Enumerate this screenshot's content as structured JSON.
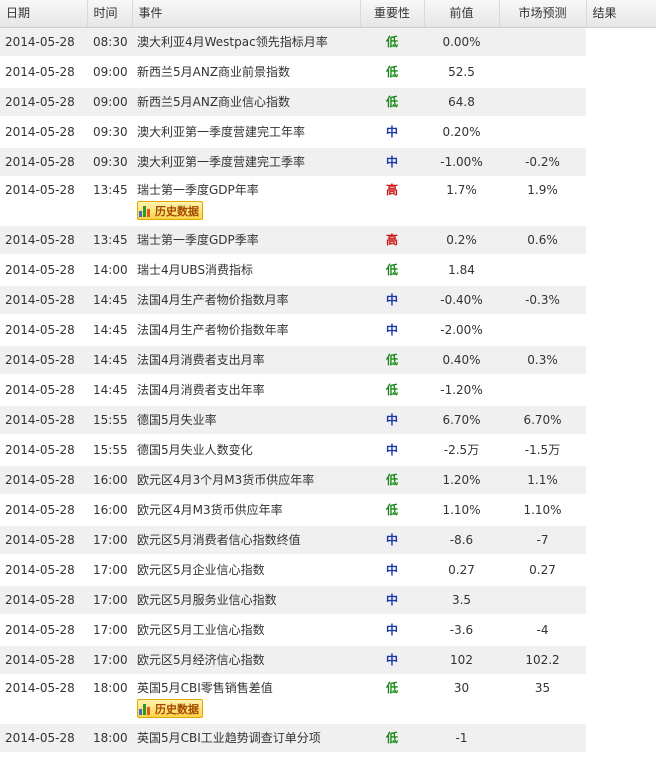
{
  "headers": {
    "date": "日期",
    "time": "时间",
    "event": "事件",
    "importance": "重要性",
    "previous": "前值",
    "forecast": "市场预测",
    "result": "结果"
  },
  "history_label": "历史数据",
  "colors": {
    "low": "#1a8a1a",
    "mid": "#1a3aa8",
    "high": "#c81414"
  },
  "rows": [
    {
      "date": "2014-05-28",
      "time": "08:30",
      "event": "澳大利亚4月Westpac领先指标月率",
      "importance": "低",
      "level": "low",
      "previous": "0.00%",
      "forecast": "",
      "has_history": false
    },
    {
      "date": "2014-05-28",
      "time": "09:00",
      "event": "新西兰5月ANZ商业前景指数",
      "importance": "低",
      "level": "low",
      "previous": "52.5",
      "forecast": "",
      "has_history": false
    },
    {
      "date": "2014-05-28",
      "time": "09:00",
      "event": "新西兰5月ANZ商业信心指数",
      "importance": "低",
      "level": "low",
      "previous": "64.8",
      "forecast": "",
      "has_history": false
    },
    {
      "date": "2014-05-28",
      "time": "09:30",
      "event": "澳大利亚第一季度营建完工年率",
      "importance": "中",
      "level": "mid",
      "previous": "0.20%",
      "forecast": "",
      "has_history": false
    },
    {
      "date": "2014-05-28",
      "time": "09:30",
      "event": "澳大利亚第一季度营建完工季率",
      "importance": "中",
      "level": "mid",
      "previous": "-1.00%",
      "forecast": "-0.2%",
      "has_history": false
    },
    {
      "date": "2014-05-28",
      "time": "13:45",
      "event": "瑞士第一季度GDP年率",
      "importance": "高",
      "level": "high",
      "previous": "1.7%",
      "forecast": "1.9%",
      "has_history": true
    },
    {
      "date": "2014-05-28",
      "time": "13:45",
      "event": "瑞士第一季度GDP季率",
      "importance": "高",
      "level": "high",
      "previous": "0.2%",
      "forecast": "0.6%",
      "has_history": false
    },
    {
      "date": "2014-05-28",
      "time": "14:00",
      "event": "瑞士4月UBS消费指标",
      "importance": "低",
      "level": "low",
      "previous": "1.84",
      "forecast": "",
      "has_history": false
    },
    {
      "date": "2014-05-28",
      "time": "14:45",
      "event": "法国4月生产者物价指数月率",
      "importance": "中",
      "level": "mid",
      "previous": "-0.40%",
      "forecast": "-0.3%",
      "has_history": false
    },
    {
      "date": "2014-05-28",
      "time": "14:45",
      "event": "法国4月生产者物价指数年率",
      "importance": "中",
      "level": "mid",
      "previous": "-2.00%",
      "forecast": "",
      "has_history": false
    },
    {
      "date": "2014-05-28",
      "time": "14:45",
      "event": "法国4月消费者支出月率",
      "importance": "低",
      "level": "low",
      "previous": "0.40%",
      "forecast": "0.3%",
      "has_history": false
    },
    {
      "date": "2014-05-28",
      "time": "14:45",
      "event": "法国4月消费者支出年率",
      "importance": "低",
      "level": "low",
      "previous": "-1.20%",
      "forecast": "",
      "has_history": false
    },
    {
      "date": "2014-05-28",
      "time": "15:55",
      "event": "德国5月失业率",
      "importance": "中",
      "level": "mid",
      "previous": "6.70%",
      "forecast": "6.70%",
      "has_history": false
    },
    {
      "date": "2014-05-28",
      "time": "15:55",
      "event": "德国5月失业人数变化",
      "importance": "中",
      "level": "mid",
      "previous": "-2.5万",
      "forecast": "-1.5万",
      "has_history": false
    },
    {
      "date": "2014-05-28",
      "time": "16:00",
      "event": "欧元区4月3个月M3货币供应年率",
      "importance": "低",
      "level": "low",
      "previous": "1.20%",
      "forecast": "1.1%",
      "has_history": false
    },
    {
      "date": "2014-05-28",
      "time": "16:00",
      "event": "欧元区4月M3货币供应年率",
      "importance": "低",
      "level": "low",
      "previous": "1.10%",
      "forecast": "1.10%",
      "has_history": false
    },
    {
      "date": "2014-05-28",
      "time": "17:00",
      "event": "欧元区5月消费者信心指数终值",
      "importance": "中",
      "level": "mid",
      "previous": "-8.6",
      "forecast": "-7",
      "has_history": false
    },
    {
      "date": "2014-05-28",
      "time": "17:00",
      "event": "欧元区5月企业信心指数",
      "importance": "中",
      "level": "mid",
      "previous": "0.27",
      "forecast": "0.27",
      "has_history": false
    },
    {
      "date": "2014-05-28",
      "time": "17:00",
      "event": "欧元区5月服务业信心指数",
      "importance": "中",
      "level": "mid",
      "previous": "3.5",
      "forecast": "",
      "has_history": false
    },
    {
      "date": "2014-05-28",
      "time": "17:00",
      "event": "欧元区5月工业信心指数",
      "importance": "中",
      "level": "mid",
      "previous": "-3.6",
      "forecast": "-4",
      "has_history": false
    },
    {
      "date": "2014-05-28",
      "time": "17:00",
      "event": "欧元区5月经济信心指数",
      "importance": "中",
      "level": "mid",
      "previous": "102",
      "forecast": "102.2",
      "has_history": false
    },
    {
      "date": "2014-05-28",
      "time": "18:00",
      "event": "英国5月CBI零售销售差值",
      "importance": "低",
      "level": "low",
      "previous": "30",
      "forecast": "35",
      "has_history": true
    },
    {
      "date": "2014-05-28",
      "time": "18:00",
      "event": "英国5月CBI工业趋势调查订单分项",
      "importance": "低",
      "level": "low",
      "previous": "-1",
      "forecast": "",
      "has_history": false
    }
  ]
}
